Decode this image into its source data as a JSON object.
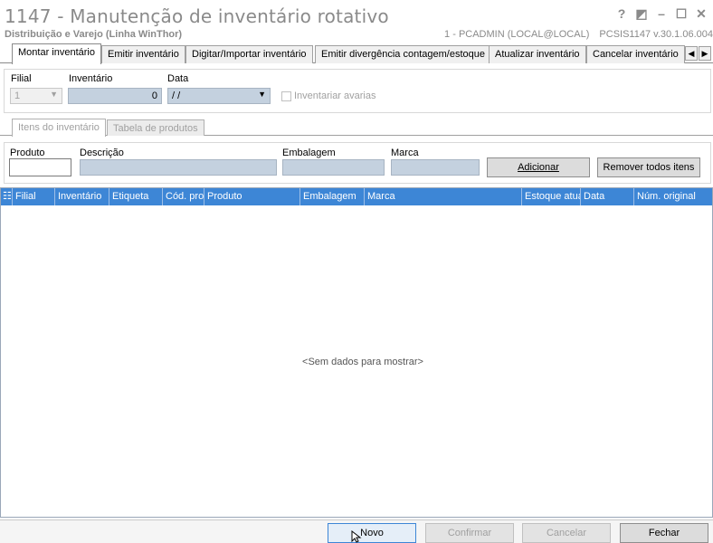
{
  "window": {
    "title": "1147 - Manutenção de inventário rotativo",
    "subtitle": "Distribuição e Varejo (Linha WinThor)",
    "user_info": "1 - PCADMIN (LOCAL@LOCAL)",
    "routine_info": "PCSIS1147  v.30.1.06.004",
    "buttons": {
      "help": "?",
      "restore": "◩",
      "minimize": "–",
      "maximize": "☐",
      "close": "✕"
    }
  },
  "tabs": [
    {
      "label": "Montar inventário",
      "active": true
    },
    {
      "label": "Emitir inventário"
    },
    {
      "label": "Digitar/Importar inventário"
    },
    {
      "label": "Emitir divergência contagem/estoque"
    },
    {
      "label": "Atualizar inventário"
    },
    {
      "label": "Cancelar inventário"
    }
  ],
  "tab_scroll": {
    "left": "◀",
    "right": "▶"
  },
  "filters": {
    "filial_label": "Filial",
    "filial_value": "1",
    "inventario_label": "Inventário",
    "inventario_value": "0",
    "data_label": "Data",
    "data_value": " / /",
    "avarias_label": "Inventariar avarias"
  },
  "subtabs": [
    {
      "label": "Itens do inventário",
      "active": true
    },
    {
      "label": "Tabela de produtos"
    }
  ],
  "item_form": {
    "produto_label": "Produto",
    "descricao_label": "Descrição",
    "embalagem_label": "Embalagem",
    "marca_label": "Marca",
    "add_button": "Adicionar",
    "remove_all_button": "Remover todos itens"
  },
  "grid": {
    "columns": [
      "Filial",
      "Inventário",
      "Etiqueta",
      "Cód. prod",
      "Produto",
      "Embalagem",
      "Marca",
      "Estoque atual",
      "Data",
      "Núm. original"
    ],
    "empty_text": "<Sem dados para mostrar>"
  },
  "footer": {
    "novo": "Novo",
    "confirmar": "Confirmar",
    "cancelar": "Cancelar",
    "fechar": "Fechar"
  }
}
